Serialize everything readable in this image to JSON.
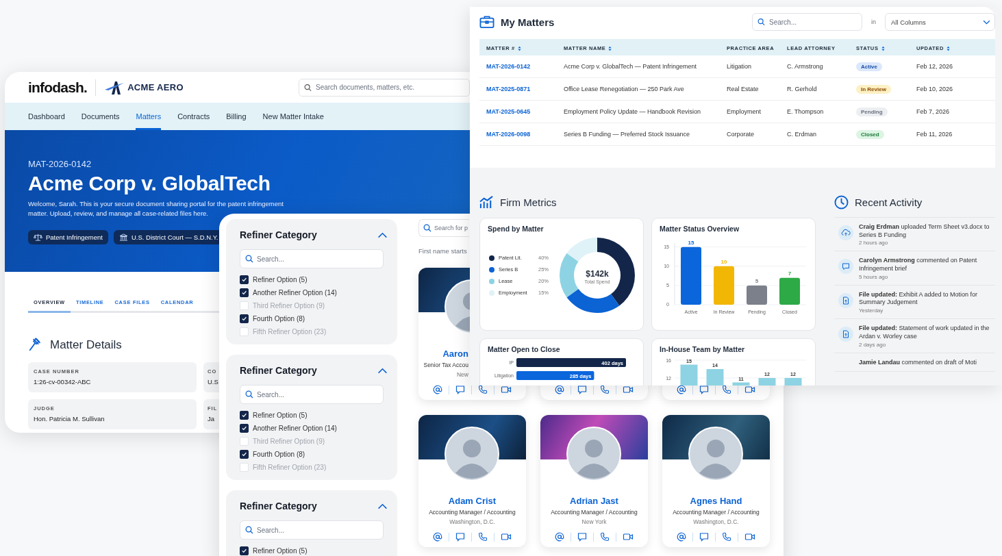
{
  "portal": {
    "brand": "infodash.",
    "client_logo": "ACME AERO",
    "search": {
      "placeholder": "Search documents, matters, etc."
    },
    "nav": [
      {
        "label": "Dashboard",
        "selected": false
      },
      {
        "label": "Documents",
        "selected": false
      },
      {
        "label": "Matters",
        "selected": true
      },
      {
        "label": "Contracts",
        "selected": false
      },
      {
        "label": "Billing",
        "selected": false
      },
      {
        "label": "New Matter Intake",
        "selected": false
      }
    ],
    "hero": {
      "matter_id": "MAT-2026-0142",
      "title": "Acme Corp v. GlobalTech",
      "welcome": "Welcome, Sarah. This is your secure document sharing portal for the patent infringement matter. Upload, review, and manage all case-related files here.",
      "chips": [
        {
          "kind": "scales",
          "label": "Patent Infringement"
        },
        {
          "kind": "court",
          "label": "U.S. District Court — S.D.N.Y."
        }
      ]
    },
    "tabs": [
      {
        "label": "OVERVIEW",
        "selected": true
      },
      {
        "label": "TIMELINE",
        "selected": false
      },
      {
        "label": "CASE FILES",
        "selected": false
      },
      {
        "label": "CALENDAR",
        "selected": false
      }
    ],
    "section_title": "Matter Details",
    "details": [
      {
        "label": "CASE NUMBER",
        "value": "1:26-cv-00342-ABC"
      },
      {
        "label": "CO",
        "value": "U.S"
      },
      {
        "label": "JUDGE",
        "value": "Hon. Patricia M. Sullivan"
      },
      {
        "label": "FIL",
        "value": "Ja"
      }
    ]
  },
  "matters": {
    "title": "My Matters",
    "search": {
      "placeholder": "Search..."
    },
    "in_label": "in",
    "column_select": "All Columns",
    "columns": [
      {
        "label": "MATTER #",
        "sortable": true
      },
      {
        "label": "MATTER NAME",
        "sortable": true
      },
      {
        "label": "PRACTICE AREA",
        "sortable": false
      },
      {
        "label": "LEAD ATTORNEY",
        "sortable": false
      },
      {
        "label": "STATUS",
        "sortable": true
      },
      {
        "label": "UPDATED",
        "sortable": true
      }
    ],
    "rows": [
      {
        "id": "MAT-2026-0142",
        "name": "Acme Corp v. GlobalTech — Patent Infringement",
        "area": "Litigation",
        "attorney": "C. Armstrong",
        "status": {
          "label": "Active",
          "kind": "active"
        },
        "updated": "Feb 12, 2026"
      },
      {
        "id": "MAT-2025-0871",
        "name": "Office Lease Renegotiation — 250 Park Ave",
        "area": "Real Estate",
        "attorney": "R. Gerhold",
        "status": {
          "label": "In Review",
          "kind": "review"
        },
        "updated": "Feb 10, 2026"
      },
      {
        "id": "MAT-2025-0645",
        "name": "Employment Policy Update — Handbook Revision",
        "area": "Employment",
        "attorney": "E. Thompson",
        "status": {
          "label": "Pending",
          "kind": "pending"
        },
        "updated": "Feb 7, 2026"
      },
      {
        "id": "MAT-2026-0098",
        "name": "Series B Funding — Preferred Stock Issuance",
        "area": "Corporate",
        "attorney": "C. Erdman",
        "status": {
          "label": "Closed",
          "kind": "closed"
        },
        "updated": "Feb 11, 2026"
      }
    ]
  },
  "metrics": {
    "title": "Firm Metrics",
    "spend": {
      "center_value": "$142k",
      "center_label": "Total Spend",
      "chart_data": {
        "type": "donut",
        "title": "Spend by Matter",
        "legend": "left",
        "categories": [
          "Patent Lit.",
          "Series B",
          "Lease",
          "Employment"
        ],
        "values": [
          40,
          25,
          20,
          15
        ],
        "value_labels": [
          "40%",
          "25%",
          "20%",
          "15%"
        ],
        "colors": [
          "#13264a",
          "#0b63d4",
          "#8dd3e3",
          "#dff2f7"
        ]
      }
    },
    "status": {
      "chart_data": {
        "type": "bar",
        "title": "Matter Status Overview",
        "categories": [
          "Active",
          "In Review",
          "Pending",
          "Closed"
        ],
        "values": [
          15,
          10,
          5,
          7
        ],
        "colors": [
          "#0b66dc",
          "#f2b705",
          "#7b808a",
          "#2daa46"
        ],
        "data_labels": true,
        "grid": true,
        "ylim": [
          0,
          16
        ],
        "yticks": [
          0,
          5,
          10,
          15
        ]
      }
    },
    "open_close": {
      "chart_data": {
        "type": "bar",
        "title": "Matter Open to Close",
        "orientation": "horizontal",
        "categories": [
          "IP",
          "Litigation"
        ],
        "values": [
          402,
          285
        ],
        "value_labels": [
          "402 days",
          "285 days"
        ],
        "colors": [
          "#13264a",
          "#0b66dc"
        ]
      }
    },
    "team": {
      "chart_data": {
        "type": "bar",
        "title": "In-House Team by Matter",
        "values": [
          15,
          14,
          11,
          12,
          12
        ],
        "color": "#8dd3e3",
        "data_labels": true,
        "ylim": [
          0,
          16
        ],
        "yticks": [
          12,
          16
        ]
      }
    }
  },
  "activity": {
    "title": "Recent Activity",
    "items": [
      {
        "kind": "upload",
        "text": "**Craig Erdman** uploaded Term Sheet v3.docx to Series B Funding",
        "time": "2 hours ago"
      },
      {
        "kind": "comment",
        "text": "**Carolyn Armstrong** commented on Patent Infringement brief",
        "time": "5 hours ago"
      },
      {
        "kind": "file",
        "text": "**File updated:** Exhibit A added to Motion for Summary Judgement",
        "time": "Yesterday"
      },
      {
        "kind": "file",
        "text": "**File updated:** Statement of work updated in the Ardan v. Worley case",
        "time": "2 days ago"
      },
      {
        "text": "**Jamie Landau** commented on draft of Moti"
      }
    ]
  },
  "directory": {
    "search": {
      "placeholder": "Search for p"
    },
    "filter_hint": "First name starts",
    "refiners": [
      {
        "title": "Refiner Category",
        "search": {
          "placeholder": "Search..."
        },
        "options": [
          {
            "label": "Refiner Option (5)",
            "checked": true
          },
          {
            "label": "Another Refiner Option (14)",
            "checked": true
          },
          {
            "label": "Third Refiner Option (9)",
            "checked": false
          },
          {
            "label": "Fourth Option (8)",
            "checked": true
          },
          {
            "label": "Fifth Refiner Option (23)",
            "checked": false
          }
        ]
      },
      {
        "title": "Refiner Category",
        "search": {
          "placeholder": "Search..."
        },
        "options": [
          {
            "label": "Refiner Option (5)",
            "checked": true
          },
          {
            "label": "Another Refiner Option (14)",
            "checked": true
          },
          {
            "label": "Third Refiner Option (9)",
            "checked": false
          },
          {
            "label": "Fourth Option (8)",
            "checked": true
          },
          {
            "label": "Fifth Refiner Option (23)",
            "checked": false
          }
        ]
      },
      {
        "title": "Refiner Category",
        "search": {
          "placeholder": "Search..."
        },
        "options": [
          {
            "label": "Refiner Option (5)",
            "checked": true
          }
        ]
      }
    ],
    "people": [
      {
        "name": "Aaron",
        "role": "Senior Tax Accou",
        "location": "New",
        "actions": [
          {
            "kind": "email"
          },
          {
            "kind": "chat"
          },
          {
            "kind": "phone"
          },
          {
            "kind": "video"
          }
        ]
      },
      {
        "actions": [
          {
            "kind": "email"
          },
          {
            "kind": "chat"
          },
          {
            "kind": "phone"
          },
          {
            "kind": "video"
          }
        ]
      },
      {
        "actions": [
          {
            "kind": "email"
          },
          {
            "kind": "chat"
          },
          {
            "kind": "phone"
          },
          {
            "kind": "video"
          }
        ]
      },
      {
        "name": "Adam Crist",
        "role": "Accounting Manager / Accounting",
        "location": "Washington, D.C.",
        "actions": [
          {
            "kind": "email"
          },
          {
            "kind": "chat"
          },
          {
            "kind": "phone"
          },
          {
            "kind": "video"
          }
        ]
      },
      {
        "name": "Adrian Jast",
        "role": "Accounting Manager / Accounting",
        "location": "New York",
        "actions": [
          {
            "kind": "email"
          },
          {
            "kind": "chat"
          },
          {
            "kind": "phone"
          },
          {
            "kind": "video"
          }
        ]
      },
      {
        "name": "Agnes Hand",
        "role": "Accounting Manager / Accounting",
        "location": "Washington, D.C.",
        "actions": [
          {
            "kind": "email"
          },
          {
            "kind": "chat"
          },
          {
            "kind": "phone"
          },
          {
            "kind": "video"
          }
        ]
      }
    ]
  }
}
